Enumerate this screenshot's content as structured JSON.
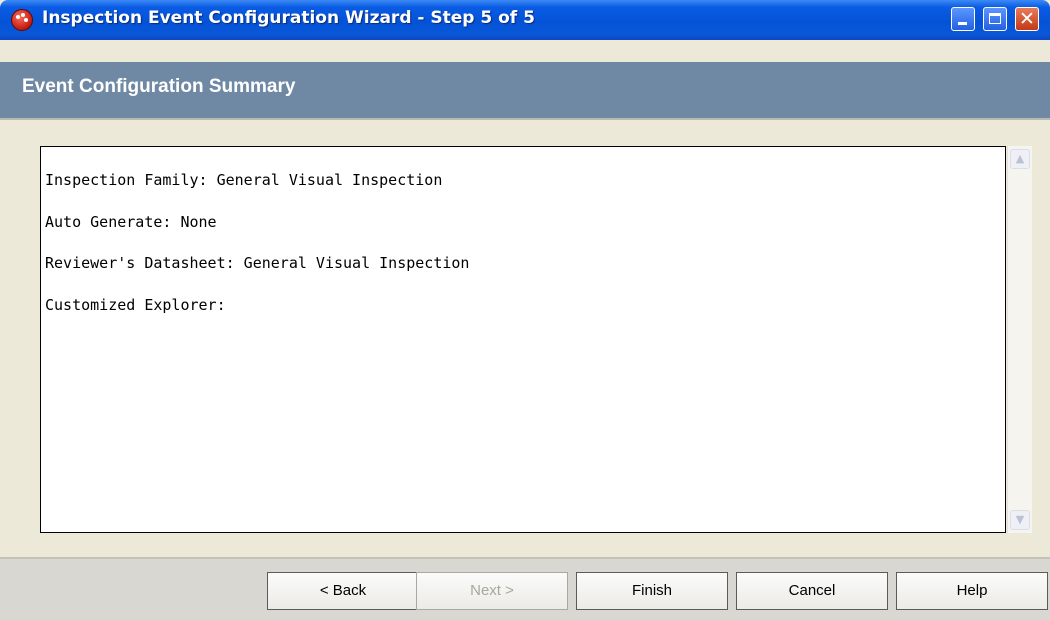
{
  "window": {
    "title": "Inspection Event Configuration Wizard - Step 5 of 5",
    "icons": [
      "app-icon",
      "minimize-icon",
      "maximize-icon",
      "close-icon"
    ]
  },
  "header": {
    "title": "Event Configuration Summary"
  },
  "summary": {
    "lines": [
      "Inspection Family: General Visual Inspection",
      "Auto Generate: None",
      "Reviewer's Datasheet: General Visual Inspection",
      "Customized Explorer:"
    ]
  },
  "buttons": {
    "back": "< Back",
    "next": "Next >",
    "finish": "Finish",
    "cancel": "Cancel",
    "help": "Help"
  },
  "colors": {
    "titlebar": "#0453d7",
    "header": "#6f88a4",
    "footer": "#d8d7d2"
  }
}
